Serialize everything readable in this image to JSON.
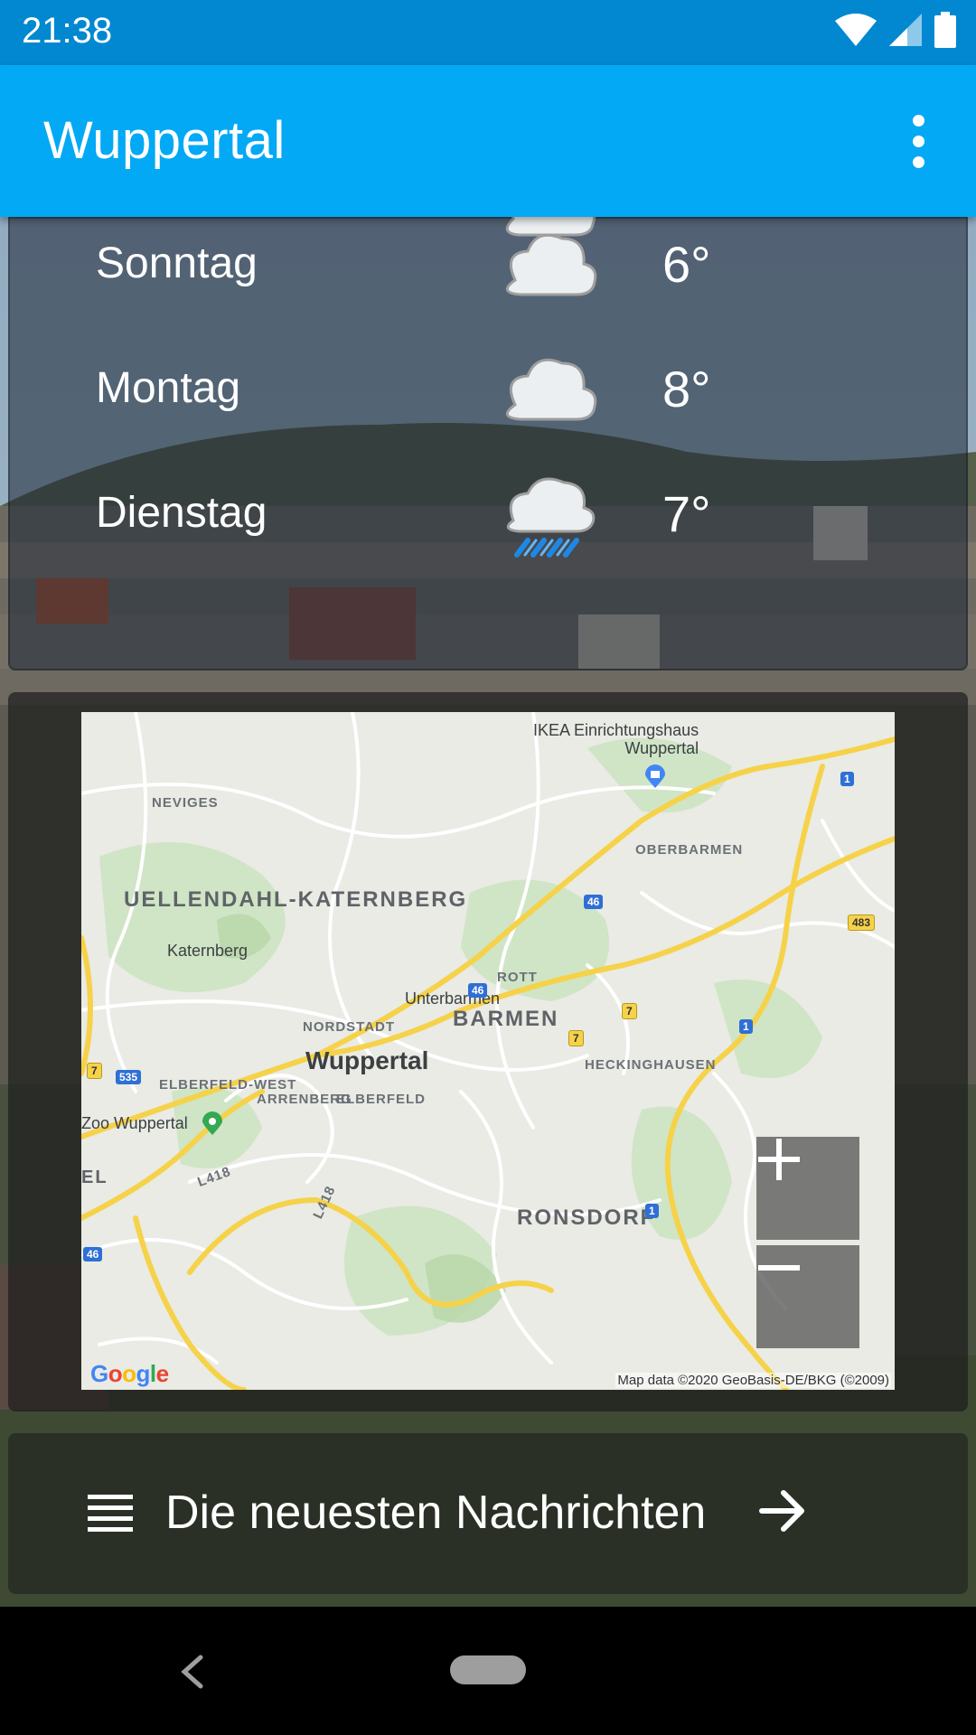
{
  "status_bar": {
    "time": "21:38"
  },
  "app_bar": {
    "title": "Wuppertal"
  },
  "forecast": {
    "rows": [
      {
        "day": "Sonntag",
        "icon": "cloud-icon",
        "temp": "6°"
      },
      {
        "day": "Montag",
        "icon": "cloud-icon",
        "temp": "8°"
      },
      {
        "day": "Dienstag",
        "icon": "rain-cloud-icon",
        "temp": "7°"
      }
    ]
  },
  "map": {
    "labels": {
      "ikea": "IKEA Einrichtungshaus\nWuppertal",
      "neviges": "NEVIGES",
      "oberbarmen": "OBERBARMEN",
      "uellendahl": "UELLENDAHL-KATERNBERG",
      "katernberg": "Katernberg",
      "rott": "ROTT",
      "unterbarmen": "Unterbarmen",
      "barmen": "BARMEN",
      "nordstadt": "NORDSTADT",
      "wuppertal": "Wuppertal",
      "heckinghausen": "HECKINGHAUSEN",
      "elberfeld_west": "ELBERFELD-WEST",
      "arrenberg": "ARRENBERG",
      "elberfeld": "ELBERFELD",
      "zoo": "Zoo Wuppertal",
      "ronsdorf": "RONSDORF",
      "el": "EL",
      "l418a": "L418",
      "l418b": "L418"
    },
    "shields": {
      "a46_top": "46",
      "a46_mid": "46",
      "a46_left": "46",
      "a1_top": "1",
      "a1_mid": "1",
      "a1_low": "1",
      "b7_a": "7",
      "b7_b": "7",
      "b7_left": "7",
      "b535": "535",
      "b483": "483"
    },
    "google_logo": "Google",
    "attribution": "Map data ©2020 GeoBasis-DE/BKG (©2009)",
    "zoom_in": "+",
    "zoom_out": "−"
  },
  "news": {
    "label": "Die neuesten Nachrichten"
  },
  "colors": {
    "status_bar": "#0288d1",
    "app_bar": "#03a9f4",
    "rain": "#2196f3"
  }
}
